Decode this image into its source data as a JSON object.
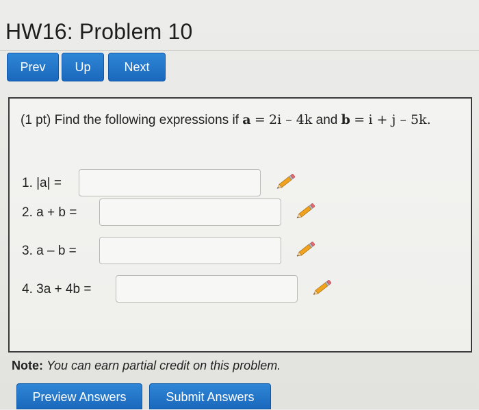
{
  "header": {
    "title": "HW16: Problem 10"
  },
  "nav": {
    "prev_label": "Prev",
    "up_label": "Up",
    "next_label": "Next"
  },
  "problem": {
    "points": "(1 pt)",
    "prompt": "Find the following expressions if",
    "a_name": "a",
    "equals": "=",
    "a_expr": "2i – 4k",
    "and_text": "and",
    "b_name": "b",
    "b_expr": "i + j – 5k."
  },
  "questions": [
    {
      "label": "1. |a| =",
      "value": ""
    },
    {
      "label": "2. a + b =",
      "value": ""
    },
    {
      "label": "3. a – b =",
      "value": ""
    },
    {
      "label": "4. 3a + 4b =",
      "value": ""
    }
  ],
  "note": {
    "label": "Note:",
    "text": "You can earn partial credit on this problem."
  },
  "actions": {
    "preview_label": "Preview Answers",
    "submit_label": "Submit Answers"
  },
  "colors": {
    "button_blue": "#1f74c9",
    "pencil_body": "#f0a21e",
    "pencil_eraser": "#e26a70"
  },
  "icons": {
    "pencil": "pencil-icon"
  }
}
